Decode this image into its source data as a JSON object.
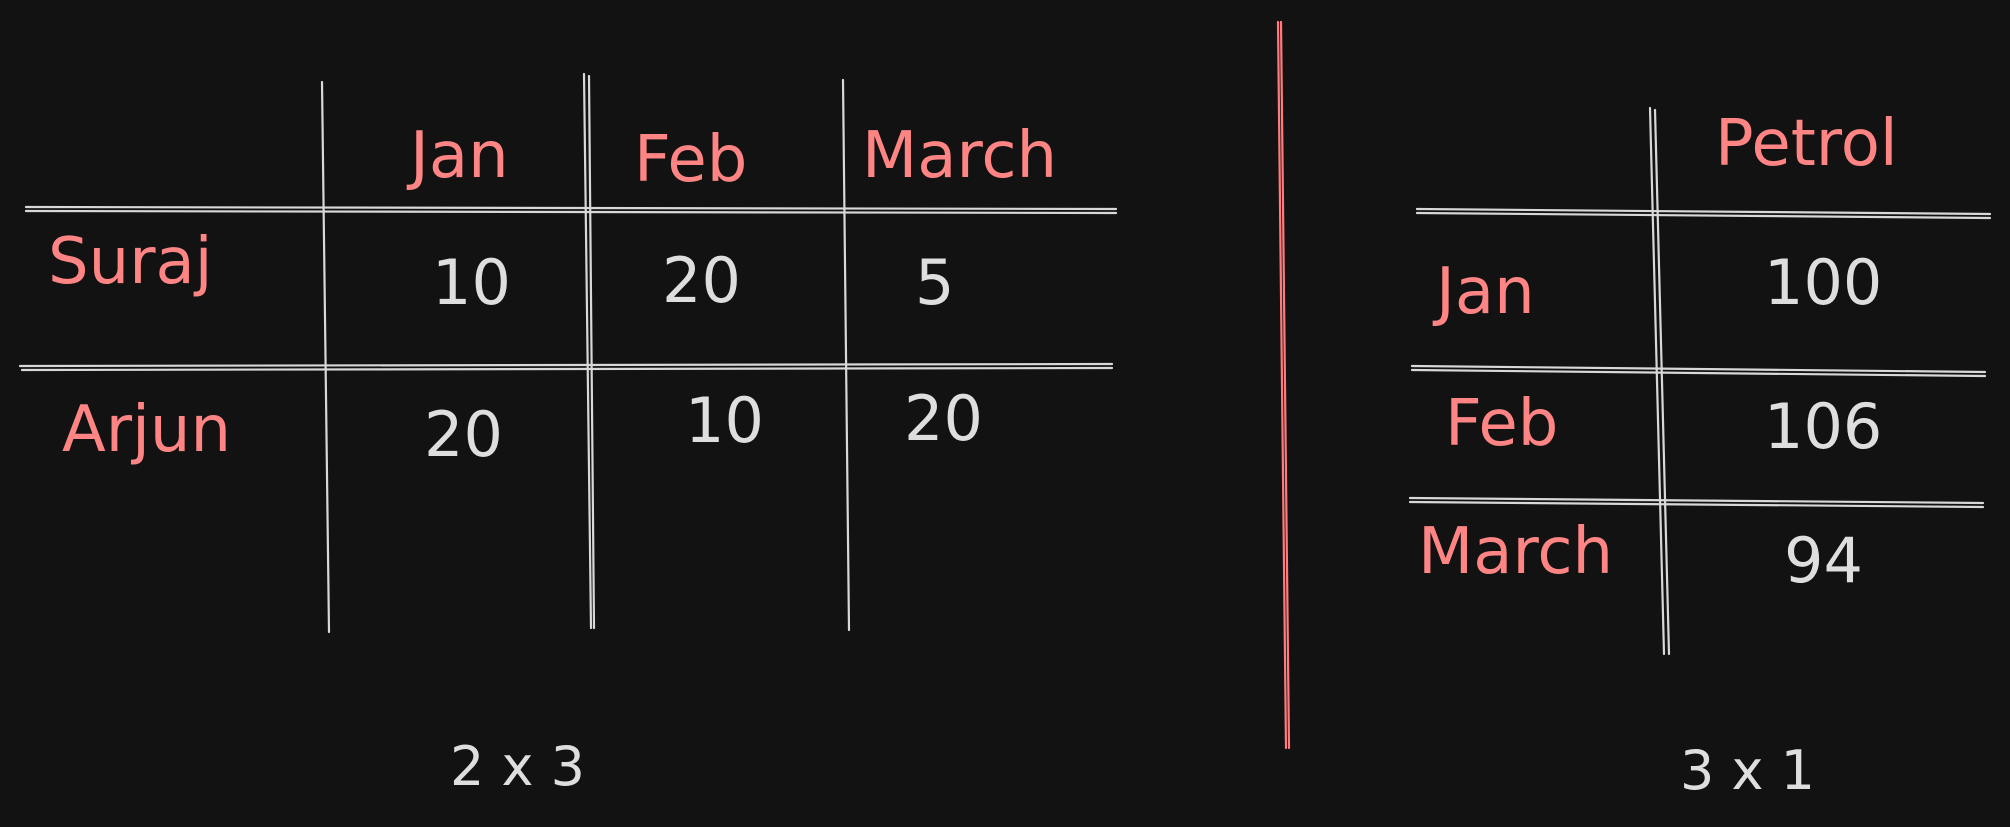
{
  "colors": {
    "background": "#121212",
    "label": "#ff8585",
    "value": "#dedede",
    "line": "#d8d8d8",
    "divider": "#ff7a7a"
  },
  "left_table": {
    "columns": [
      "Jan",
      "Feb",
      "March"
    ],
    "rows": [
      {
        "label": "Suraj",
        "values": [
          "10",
          "20",
          "5"
        ]
      },
      {
        "label": "Arjun",
        "values": [
          "20",
          "10",
          "20"
        ]
      }
    ],
    "dimension": "2 x 3"
  },
  "right_table": {
    "columns": [
      "Petrol"
    ],
    "rows": [
      {
        "label": "Jan",
        "values": [
          "100"
        ]
      },
      {
        "label": "Feb",
        "values": [
          "106"
        ]
      },
      {
        "label": "March",
        "values": [
          "94"
        ]
      }
    ],
    "dimension": "3 x 1"
  }
}
